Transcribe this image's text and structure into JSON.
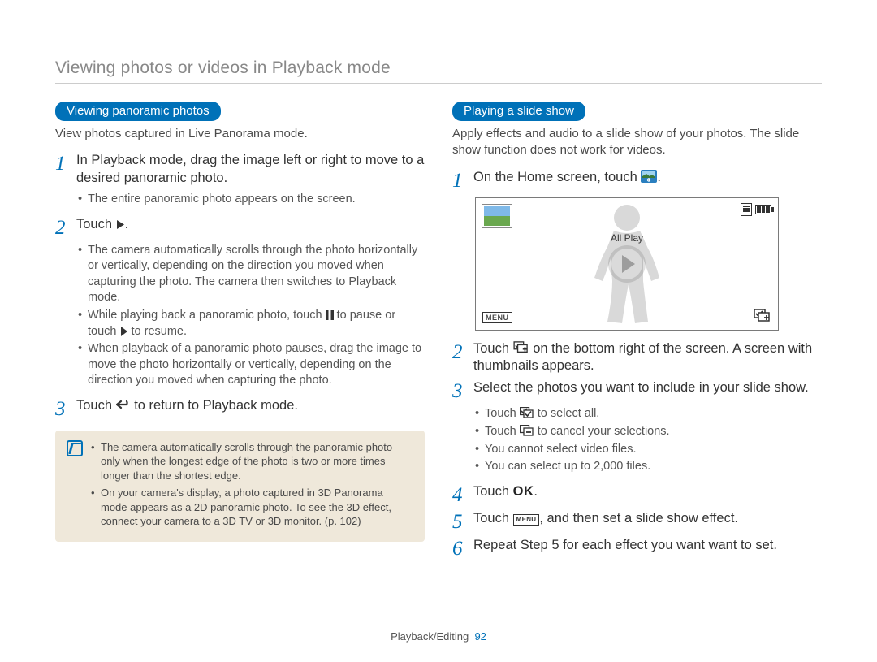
{
  "header": {
    "title": "Viewing photos or videos in Playback mode"
  },
  "left": {
    "pill": "Viewing panoramic photos",
    "intro": "View photos captured in Live Panorama mode.",
    "step1": "In Playback mode, drag the image left or right to move to a desired panoramic photo.",
    "step1_sub1": "The entire panoramic photo appears on the screen.",
    "step2_a": "Touch ",
    "step2_b": ".",
    "step2_sub1": "The camera automatically scrolls through the photo horizontally or vertically, depending on the direction you moved when capturing the photo. The camera then switches to Playback mode.",
    "step2_sub2_a": "While playing back a panoramic photo, touch ",
    "step2_sub2_b": " to pause or touch ",
    "step2_sub2_c": " to resume.",
    "step2_sub3": "When playback of a panoramic photo pauses, drag the image to move the photo horizontally or vertically, depending on the direction you moved when capturing the photo.",
    "step3_a": "Touch ",
    "step3_b": " to return to Playback mode.",
    "note1": "The camera automatically scrolls through the panoramic photo only when the longest edge of the photo is two or more times longer than the shortest edge.",
    "note2": "On your camera's display, a photo captured in 3D Panorama mode appears as a 2D panoramic photo. To see the 3D effect, connect your camera to a 3D TV or 3D monitor. (p. 102)"
  },
  "right": {
    "pill": "Playing a slide show",
    "intro": "Apply effects and audio to a slide show of your photos. The slide show function does not work for videos.",
    "step1_a": "On the Home screen, touch ",
    "step1_b": ".",
    "allplay": "All Play",
    "menu_label": "MENU",
    "step2_a": "Touch ",
    "step2_b": " on the bottom right of the screen. A screen with thumbnails appears.",
    "step3": "Select the photos you want to include in your slide show.",
    "step3_sub1_a": "Touch ",
    "step3_sub1_b": " to select all.",
    "step3_sub2_a": "Touch ",
    "step3_sub2_b": " to cancel your selections.",
    "step3_sub3": "You cannot select video files.",
    "step3_sub4": "You can select up to 2,000 files.",
    "step4_a": "Touch ",
    "step4_ok": "OK",
    "step4_b": ".",
    "step5_a": "Touch ",
    "step5_b": ", and then set a slide show effect.",
    "step6": "Repeat Step 5 for each effect you want want to set."
  },
  "footer": {
    "section": "Playback/Editing",
    "page": "92"
  }
}
